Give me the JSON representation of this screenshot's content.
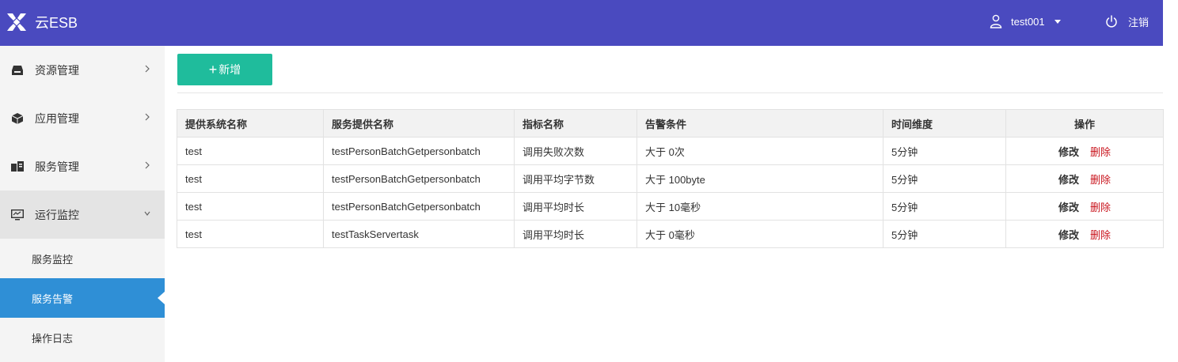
{
  "header": {
    "app_title": "云ESB",
    "user_name": "test001",
    "logout_label": "注销"
  },
  "sidebar": {
    "items": [
      {
        "label": "资源管理",
        "icon": "inbox-icon"
      },
      {
        "label": "应用管理",
        "icon": "cube-icon"
      },
      {
        "label": "服务管理",
        "icon": "server-icon"
      },
      {
        "label": "运行监控",
        "icon": "monitor-icon"
      }
    ],
    "subitems": [
      {
        "label": "服务监控"
      },
      {
        "label": "服务告警",
        "active": true
      },
      {
        "label": "操作日志"
      }
    ]
  },
  "toolbar": {
    "add_plus": "+",
    "add_label": "新增"
  },
  "table": {
    "headers": [
      "提供系统名称",
      "服务提供名称",
      "指标名称",
      "告警条件",
      "时间维度",
      "操作"
    ],
    "rows": [
      {
        "system": "test",
        "service": "testPersonBatchGetpersonbatch",
        "metric": "调用失败次数",
        "condition": "大于 0次",
        "window": "5分钟"
      },
      {
        "system": "test",
        "service": "testPersonBatchGetpersonbatch",
        "metric": "调用平均字节数",
        "condition": "大于 100byte",
        "window": "5分钟"
      },
      {
        "system": "test",
        "service": "testPersonBatchGetpersonbatch",
        "metric": "调用平均时长",
        "condition": "大于 10毫秒",
        "window": "5分钟"
      },
      {
        "system": "test",
        "service": "testTaskServertask",
        "metric": "调用平均时长",
        "condition": "大于 0毫秒",
        "window": "5分钟"
      }
    ],
    "edit_label": "修改",
    "delete_label": "删除"
  },
  "colors": {
    "header_bg": "#4a4abf",
    "active_nav": "#2f8fd6",
    "add_button": "#1fbc9c",
    "delete_text": "#c9151e"
  }
}
